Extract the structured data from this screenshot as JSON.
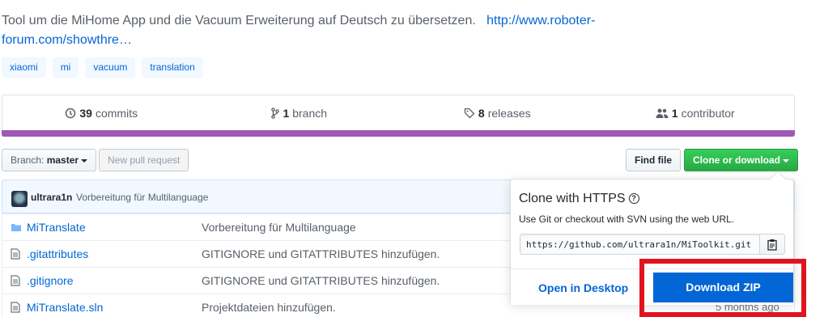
{
  "repo": {
    "description": "Tool um die MiHome App und die Vacuum Erweiterung auf Deutsch zu übersetzen.",
    "link_line1": "http://www.roboter-",
    "link_line2": "forum.com/showthre…",
    "topics": [
      "xiaomi",
      "mi",
      "vacuum",
      "translation"
    ]
  },
  "summary": {
    "commits_count": "39",
    "commits_label": "commits",
    "branch_count": "1",
    "branch_label": "branch",
    "releases_count": "8",
    "releases_label": "releases",
    "contributor_count": "1",
    "contributor_label": "contributor",
    "language_color": "#9e58b5"
  },
  "toolbar": {
    "branch_prefix": "Branch:",
    "branch_name": "master",
    "new_pull_request": "New pull request",
    "find_file": "Find file",
    "clone_or_download": "Clone or download"
  },
  "commit": {
    "author": "ultrara1n",
    "message": "Vorbereitung für Multilanguage"
  },
  "files": [
    {
      "name": "MiTranslate",
      "type": "folder",
      "message": "Vorbereitung für Multilanguage"
    },
    {
      "name": ".gitattributes",
      "type": "file",
      "message": "GITIGNORE und GITATTRIBUTES hinzufügen."
    },
    {
      "name": ".gitignore",
      "type": "file",
      "message": "GITIGNORE und GITATTRIBUTES hinzufügen."
    },
    {
      "name": "MiTranslate.sln",
      "type": "file",
      "message": "Projektdateien hinzufügen."
    }
  ],
  "last_age": "5 months ago",
  "clone_popup": {
    "title": "Clone with HTTPS",
    "subtitle": "Use Git or checkout with SVN using the web URL.",
    "url": "https://github.com/ultrara1n/MiToolkit.git",
    "open_desktop": "Open in Desktop",
    "download_zip": "Download ZIP"
  },
  "colors": {
    "link": "#0366d6",
    "green": "#28a745",
    "highlight": "#e0141e"
  }
}
